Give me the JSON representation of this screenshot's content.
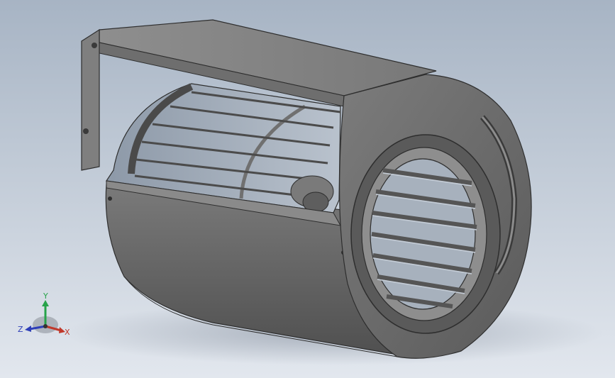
{
  "viewport": {
    "background_top": "#a9b6c6",
    "background_bottom": "#dfe5ec",
    "model_color": "#6b6b6b",
    "model_dark": "#4a4a4a",
    "model_light": "#8a8a8a"
  },
  "triad": {
    "x_label": "X",
    "y_label": "Y",
    "z_label": "Z",
    "x_color": "#c0392b",
    "y_color": "#27a34a",
    "z_color": "#2e3fb8"
  }
}
